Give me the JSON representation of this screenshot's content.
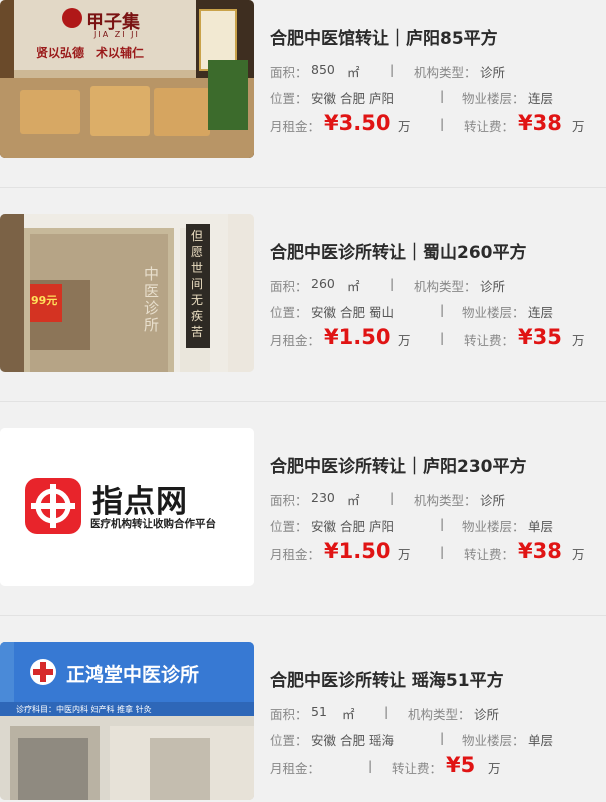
{
  "listings": [
    {
      "title": "合肥中医馆转让｜庐阳85平方",
      "area_label": "面积：",
      "area_value": "850",
      "area_unit": "㎡",
      "type_label": "机构类型：",
      "type_value": "诊所",
      "loc_label": "位置：",
      "loc_value": "安徽 合肥 庐阳",
      "floor_label": "物业楼层：",
      "floor_value": "连层",
      "rent_label": "月租金：",
      "rent_value": "¥3.50",
      "rent_unit": "万",
      "fee_label": "转让费：",
      "fee_value": "¥38",
      "fee_unit": "万",
      "sign_main": "甲子集",
      "sign_sub": "JIA ZI JI",
      "slogan": "贤以弘德　术以辅仁"
    },
    {
      "title": "合肥中医诊所转让｜蜀山260平方",
      "area_label": "面积：",
      "area_value": "260",
      "area_unit": "㎡",
      "type_label": "机构类型：",
      "type_value": "诊所",
      "loc_label": "位置：",
      "loc_value": "安徽 合肥 蜀山",
      "floor_label": "物业楼层：",
      "floor_value": "连层",
      "rent_label": "月租金：",
      "rent_value": "¥1.50",
      "rent_unit": "万",
      "fee_label": "转让费：",
      "fee_value": "¥35",
      "fee_unit": "万",
      "door_text": "中医诊所",
      "couplet": "但愿世间无疾苦",
      "badge": "99元"
    },
    {
      "title": "合肥中医诊所转让｜庐阳230平方",
      "area_label": "面积：",
      "area_value": "230",
      "area_unit": "㎡",
      "type_label": "机构类型：",
      "type_value": "诊所",
      "loc_label": "位置：",
      "loc_value": "安徽 合肥 庐阳",
      "floor_label": "物业楼层：",
      "floor_value": "单层",
      "rent_label": "月租金：",
      "rent_value": "¥1.50",
      "rent_unit": "万",
      "fee_label": "转让费：",
      "fee_value": "¥38",
      "fee_unit": "万",
      "logo_text": "指点网",
      "logo_sub": "医疗机构转让收购合作平台"
    },
    {
      "title": "合肥中医诊所转让 瑶海51平方",
      "area_label": "面积：",
      "area_value": "51",
      "area_unit": "㎡",
      "type_label": "机构类型：",
      "type_value": "诊所",
      "loc_label": "位置：",
      "loc_value": "安徽 合肥 瑶海",
      "floor_label": "物业楼层：",
      "floor_value": "单层",
      "rent_label": "月租金：",
      "rent_value": "",
      "fee_label": "转让费：",
      "fee_value": "¥5",
      "fee_unit": "万",
      "sign_main": "正鸿堂中医诊所",
      "sign_sub": "诊疗科目：中医内科 妇产科 推拿 针灸"
    }
  ],
  "colors": {
    "price": "#e01414",
    "background": "#f1f1f1"
  }
}
